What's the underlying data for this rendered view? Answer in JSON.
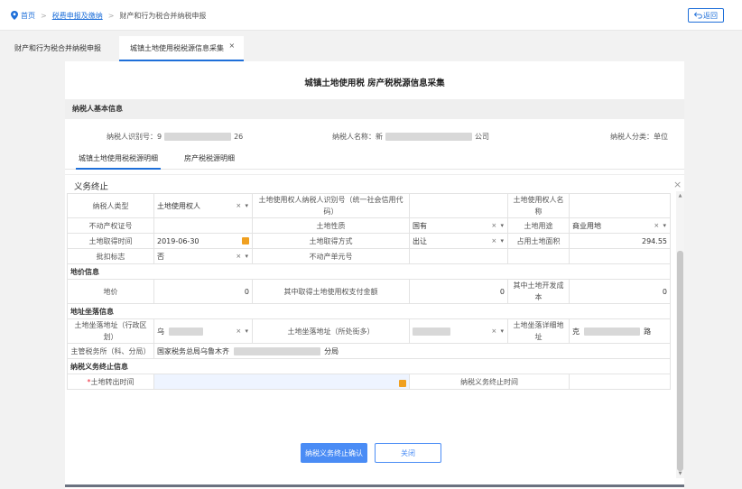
{
  "breadcrumb": {
    "home": "首页",
    "sep": ">",
    "level1": "税费申报及缴纳",
    "current": "财产和行为税合并纳税申报"
  },
  "back_button": "返回",
  "tabs": [
    {
      "label": "财产和行为税合并纳税申报"
    },
    {
      "label": "城镇土地使用税税源信息采集",
      "close": "×"
    }
  ],
  "panel": {
    "title": "城镇土地使用税 房产税税源信息采集",
    "section_basic": "纳税人基本信息",
    "taxpayer_id_label": "纳税人识别号：",
    "taxpayer_id_start": "9",
    "taxpayer_id_end": "26",
    "taxpayer_name_label": "纳税人名称：",
    "taxpayer_name_start": "新",
    "taxpayer_name_end": "公司",
    "taxpayer_type_label": "纳税人分类：",
    "taxpayer_type_value": "单位",
    "subtabs": [
      "城镇土地使用税税源明细",
      "房产税税源明细"
    ]
  },
  "modal": {
    "title": "义务终止",
    "close": "×",
    "rows": {
      "payer_type_label": "纳税人类型",
      "payer_type_value": "土地使用权人",
      "user_id_label": "土地使用权人纳税人识别号（统一社会信用代码）",
      "user_name_label": "土地使用权人名称",
      "cert_label": "不动产权证号",
      "nature_label": "土地性质",
      "nature_value": "国有",
      "usage_label": "土地用途",
      "usage_value": "商业用地",
      "acq_time_label": "土地取得时间",
      "acq_time_value": "2019-06-30",
      "acq_method_label": "土地取得方式",
      "acq_method_value": "出让",
      "area_label": "占用土地面积",
      "area_value": "294.55",
      "flag_label": "批扣标志",
      "flag_value": "否",
      "unit_label": "不动产单元号",
      "section_price": "地价信息",
      "price_label": "地价",
      "price_value": "0",
      "use_fee_label": "其中取得土地使用权支付金额",
      "use_fee_value": "0",
      "dev_cost_label": "其中土地开发成本",
      "dev_cost_value": "0",
      "section_location": "地址坐落信息",
      "district_label": "土地坐落地址（行政区划）",
      "district_value": "乌",
      "street_label": "土地坐落地址（所处街多）",
      "detail_label": "土地坐落详细地址",
      "detail_start": "克",
      "detail_end": "路",
      "office_label": "主管税务所（科、分局）",
      "office_start": "国家税务总局乌鲁木齐",
      "office_end": "分局",
      "section_end": "纳税义务终止信息",
      "transfer_label": "土地转出时间",
      "required_mark": "*",
      "end_time_label": "纳税义务终止时间"
    },
    "clear_mark": "× ▾",
    "confirm_button": "纳税义务终止确认",
    "close_button": "关闭"
  },
  "colors": {
    "accent": "#1e6fd9",
    "confirm": "#4a8cf5",
    "calendar": "#f0a020"
  }
}
